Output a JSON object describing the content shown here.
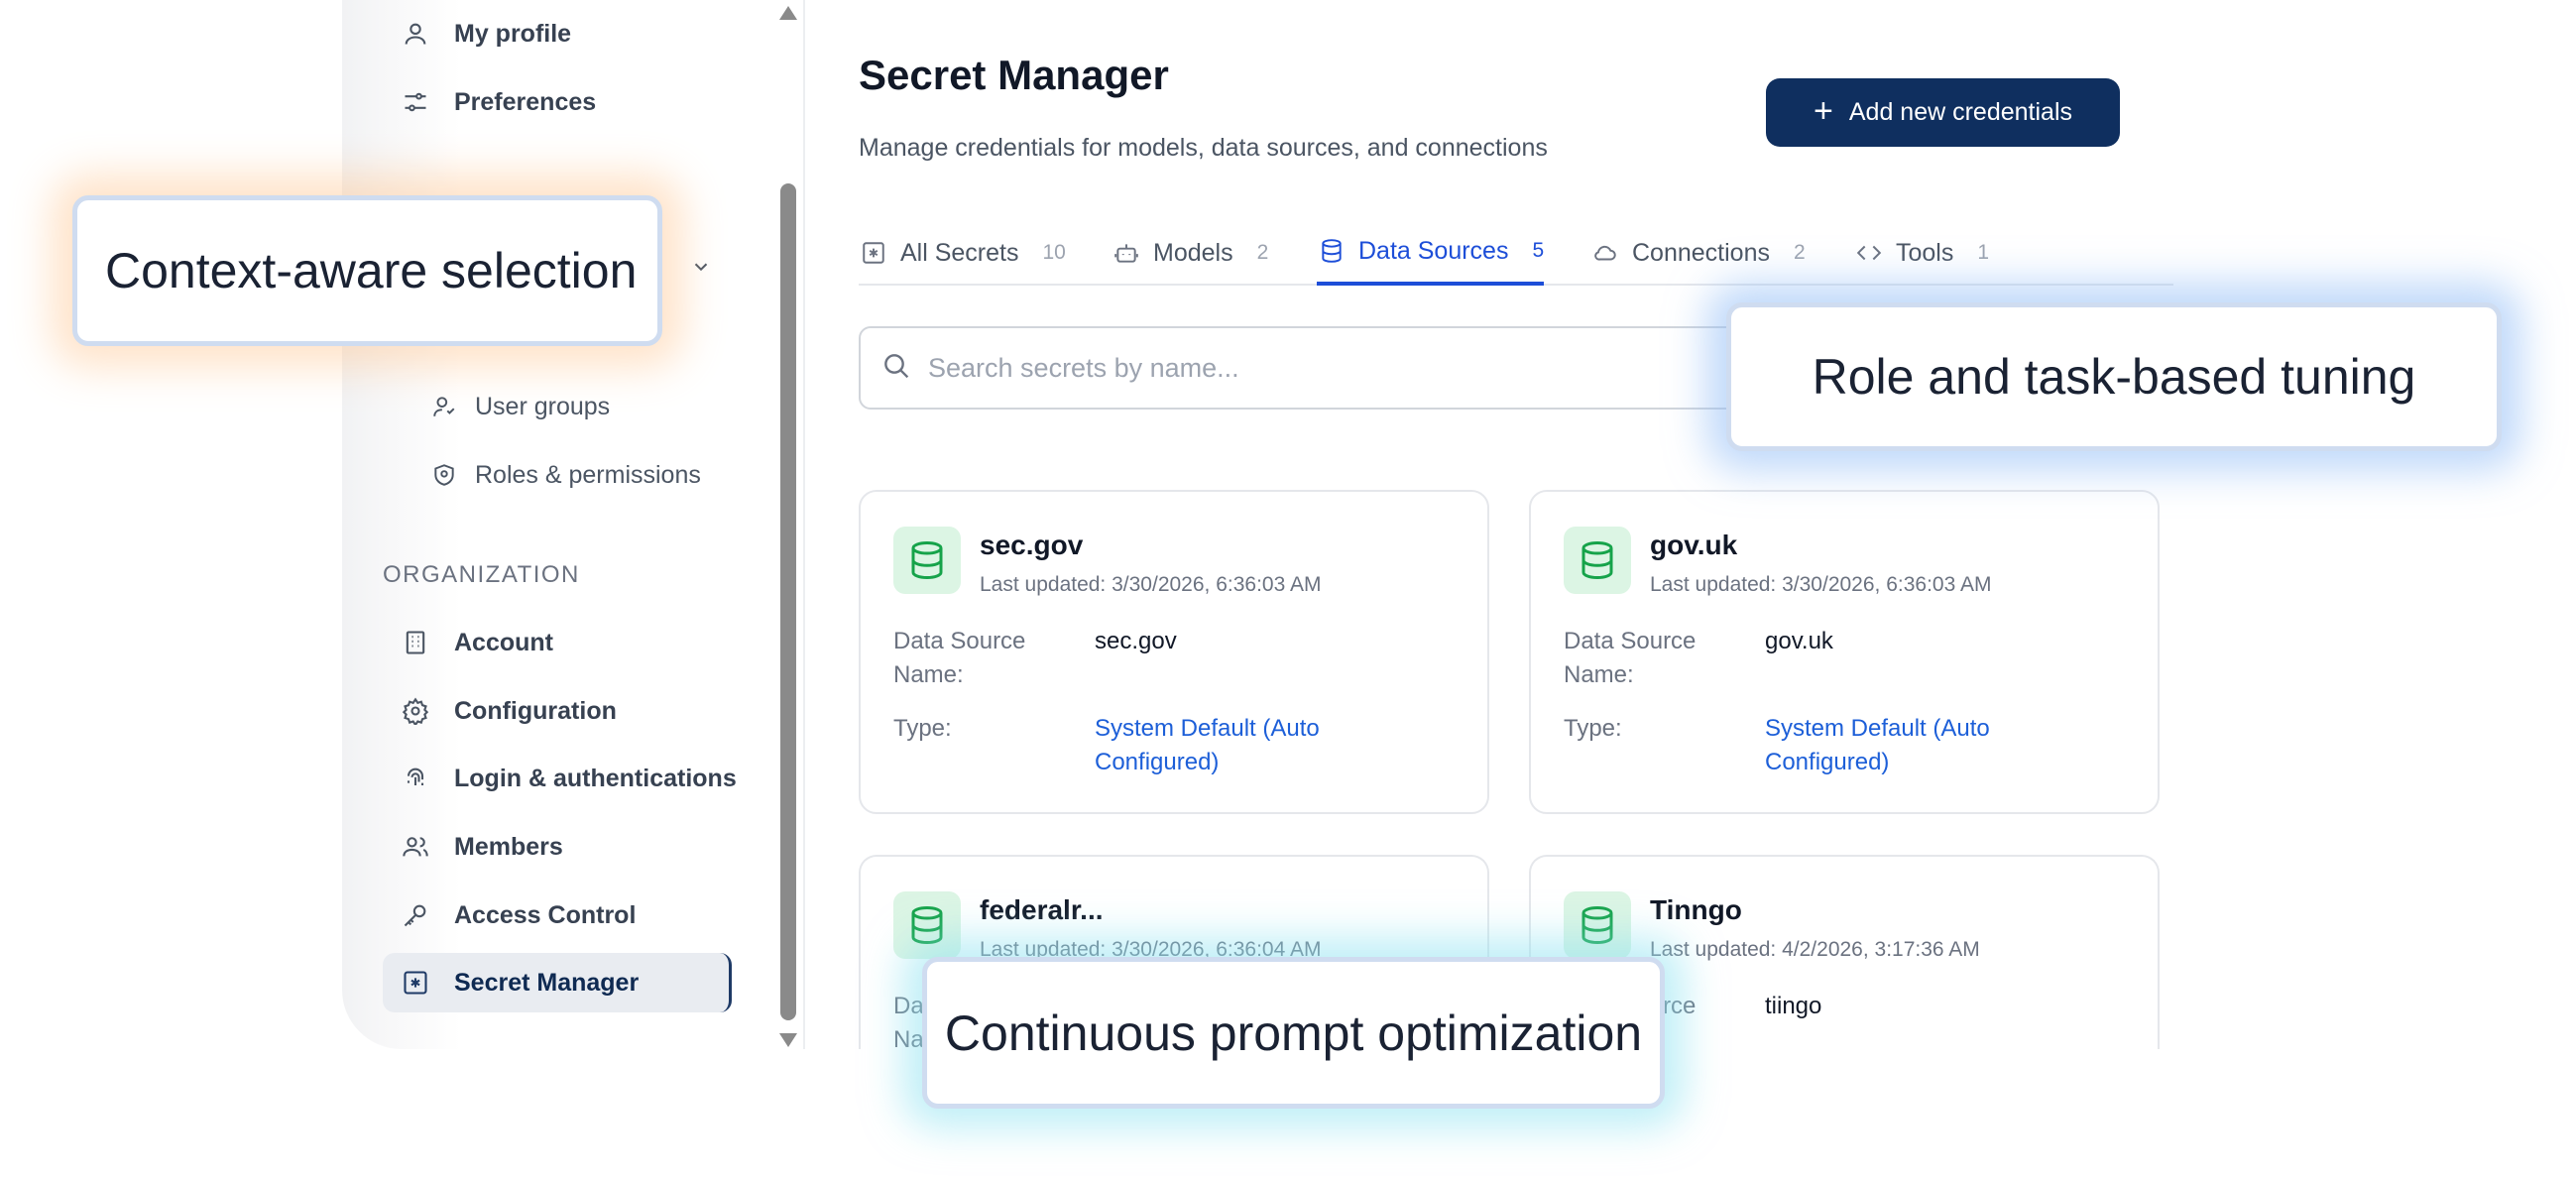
{
  "sidebar": {
    "items_top": [
      {
        "label": "My profile",
        "icon": "user-icon"
      },
      {
        "label": "Preferences",
        "icon": "sliders-icon"
      }
    ],
    "sub_items": [
      {
        "label": "User groups",
        "icon": "user-group-icon"
      },
      {
        "label": "Roles & permissions",
        "icon": "shield-icon"
      }
    ],
    "section_label": "ORGANIZATION",
    "org_items": [
      {
        "label": "Account",
        "icon": "building-icon"
      },
      {
        "label": "Configuration",
        "icon": "gear-icon"
      },
      {
        "label": "Login & authentications",
        "icon": "fingerprint-icon"
      },
      {
        "label": "Members",
        "icon": "users-icon"
      },
      {
        "label": "Access Control",
        "icon": "key-icon"
      },
      {
        "label": "Secret Manager",
        "icon": "asterisk-box-icon",
        "active": true
      }
    ]
  },
  "main": {
    "title": "Secret Manager",
    "subtitle": "Manage credentials for models, data sources, and connections",
    "add_button": "Add new credentials",
    "tabs": [
      {
        "label": "All Secrets",
        "count": "10",
        "icon": "asterisk-box-icon"
      },
      {
        "label": "Models",
        "count": "2",
        "icon": "robot-icon"
      },
      {
        "label": "Data Sources",
        "count": "5",
        "icon": "database-icon",
        "active": true
      },
      {
        "label": "Connections",
        "count": "2",
        "icon": "cloud-icon"
      },
      {
        "label": "Tools",
        "count": "1",
        "icon": "code-icon"
      }
    ],
    "search_placeholder": "Search secrets by name...",
    "cards": [
      {
        "name": "sec.gov",
        "updated": "Last updated: 3/30/2026, 6:36:03 AM",
        "ds_label": "Data Source Name:",
        "ds_value": "sec.gov",
        "type_label": "Type:",
        "type_value": "System Default (Auto Configured)"
      },
      {
        "name": "gov.uk",
        "updated": "Last updated: 3/30/2026, 6:36:03 AM",
        "ds_label": "Data Source Name:",
        "ds_value": "gov.uk",
        "type_label": "Type:",
        "type_value": "System Default (Auto Configured)"
      },
      {
        "name": "federalr...",
        "updated": "Last updated: 3/30/2026, 6:36:04 AM",
        "ds_label": "Data Source Name:",
        "ds_value": "",
        "type_label": "",
        "type_value": ""
      },
      {
        "name": "Tinngo",
        "updated": "Last updated: 4/2/2026, 3:17:36 AM",
        "ds_label": "Data Source Name:",
        "ds_value": "tiingo",
        "type_label": "",
        "type_value": ""
      }
    ]
  },
  "callouts": {
    "context": "Context-aware selection",
    "role": "Role and task-based tuning",
    "prompt": "Continuous prompt optimization"
  },
  "colors": {
    "primary": "#0f2f5f",
    "active_tab": "#1d4ed8",
    "link": "#1d5fd8",
    "db_icon": "#16a34a",
    "db_icon_bg": "#dcf5e4"
  }
}
